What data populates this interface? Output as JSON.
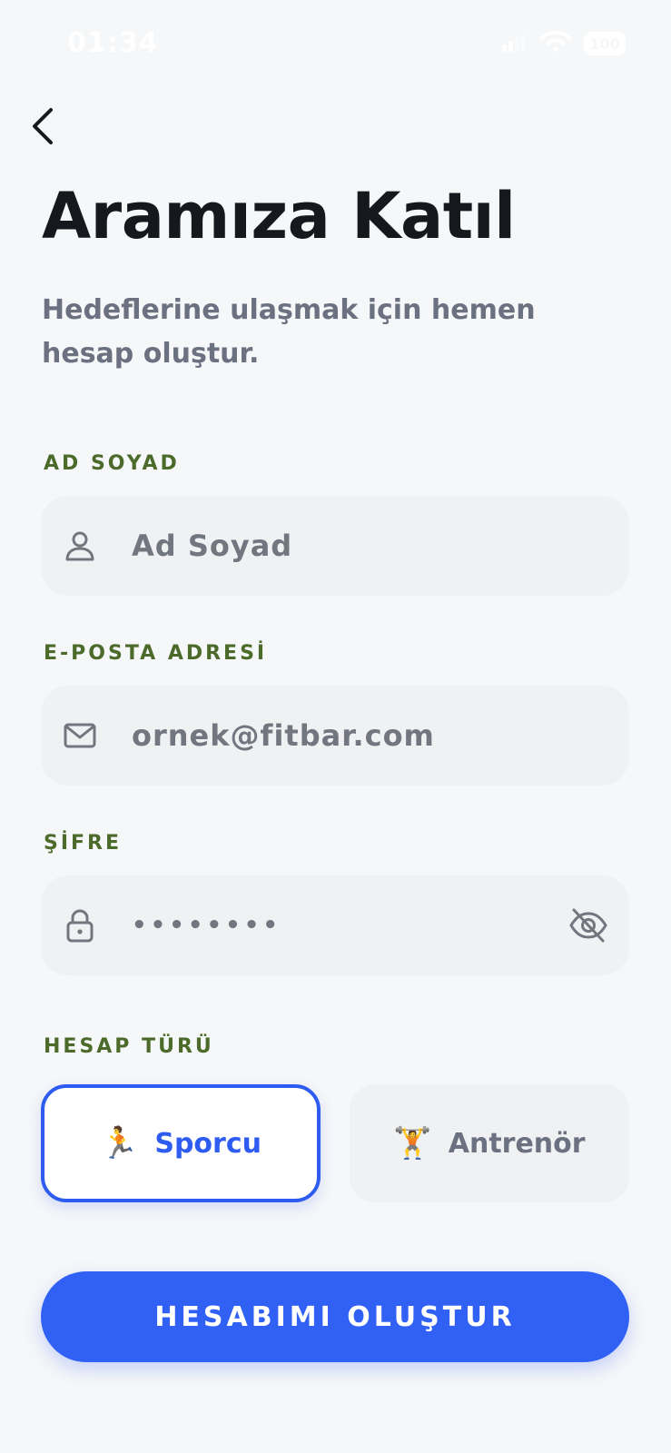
{
  "status_bar": {
    "time": "01:34",
    "battery": "100",
    "icons": [
      "cellular-signal-icon",
      "wifi-icon",
      "battery-icon"
    ]
  },
  "header": {
    "back_icon": "chevron-left-icon",
    "title": "Aramıza Katıl",
    "subtitle": "Hedeflerine ulaşmak için hemen hesap oluştur."
  },
  "form": {
    "name": {
      "label": "AD SOYAD",
      "placeholder": "Ad Soyad",
      "icon": "user-icon"
    },
    "email": {
      "label": "E-POSTA ADRESİ",
      "placeholder": "ornek@fitbar.com",
      "icon": "mail-icon"
    },
    "password": {
      "label": "ŞİFRE",
      "value": "••••••••",
      "icon": "lock-icon",
      "toggle_icon": "eye-off-icon"
    },
    "account_type": {
      "label": "HESAP TÜRÜ",
      "selected": "Sporcu",
      "options": [
        {
          "label": "Sporcu",
          "emoji": "🏃",
          "icon": "runner-icon"
        },
        {
          "label": "Antrenör",
          "emoji": "🏋️",
          "icon": "weightlifter-icon"
        }
      ]
    },
    "submit_label": "HESABIMI OLUŞTUR"
  },
  "colors": {
    "background": "#f6f7f9",
    "accent": "#3160f5",
    "label": "#4c6a2a",
    "field_bg": "#f0f1f3",
    "muted_text": "#6b7180"
  }
}
